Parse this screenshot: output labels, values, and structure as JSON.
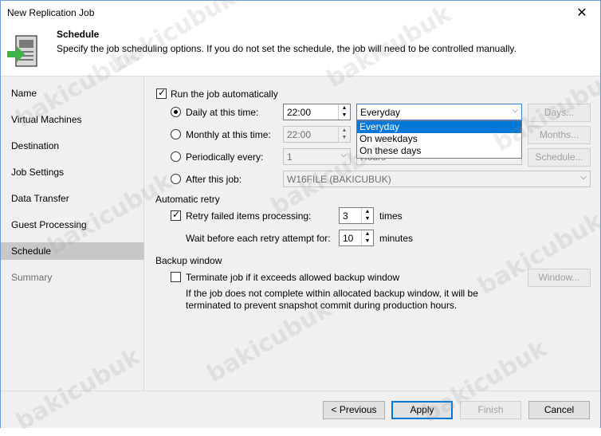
{
  "window": {
    "title": "New Replication Job",
    "close_glyph": "✕"
  },
  "header": {
    "title": "Schedule",
    "description": "Specify the job scheduling options. If you do not set the schedule, the job will need to be controlled manually.",
    "icon": "schedule-wizard-icon"
  },
  "sidebar": {
    "items": [
      {
        "label": "Name",
        "state": "normal"
      },
      {
        "label": "Virtual Machines",
        "state": "normal"
      },
      {
        "label": "Destination",
        "state": "normal"
      },
      {
        "label": "Job Settings",
        "state": "normal"
      },
      {
        "label": "Data Transfer",
        "state": "normal"
      },
      {
        "label": "Guest Processing",
        "state": "normal"
      },
      {
        "label": "Schedule",
        "state": "active"
      },
      {
        "label": "Summary",
        "state": "disabled"
      }
    ]
  },
  "schedule": {
    "run_auto_label": "Run the job automatically",
    "run_auto_checked": true,
    "daily_label": "Daily at this time:",
    "daily_time": "22:00",
    "daily_combo": "Everyday",
    "days_button": "Days...",
    "monthly_label": "Monthly at this time:",
    "monthly_time": "22:00",
    "months_button": "Months...",
    "periodic_label": "Periodically every:",
    "periodic_value": "1",
    "periodic_unit": "Hours",
    "schedule_button": "Schedule...",
    "after_label": "After this job:",
    "after_value": "W16FILE (BAKICUBUK)",
    "dropdown_options": [
      "Everyday",
      "On weekdays",
      "On these days"
    ]
  },
  "retry": {
    "section_label": "Automatic retry",
    "retry_label": "Retry failed items processing:",
    "retry_checked": true,
    "retry_value": "3",
    "retry_unit": "times",
    "wait_label": "Wait before each retry attempt for:",
    "wait_value": "10",
    "wait_unit": "minutes"
  },
  "backup_window": {
    "section_label": "Backup window",
    "terminate_label": "Terminate job if it exceeds allowed backup window",
    "terminate_checked": false,
    "note_line1": "If the job does not complete within allocated backup window, it will be",
    "note_line2": "terminated to prevent snapshot commit during production hours.",
    "window_button": "Window..."
  },
  "footer": {
    "previous": "< Previous",
    "apply": "Apply",
    "finish": "Finish",
    "cancel": "Cancel"
  },
  "watermark": "bakicubuk",
  "colors": {
    "accent": "#0078d7",
    "sidebar_active": "#c8c8c8",
    "icon_green": "#3fb24a"
  }
}
